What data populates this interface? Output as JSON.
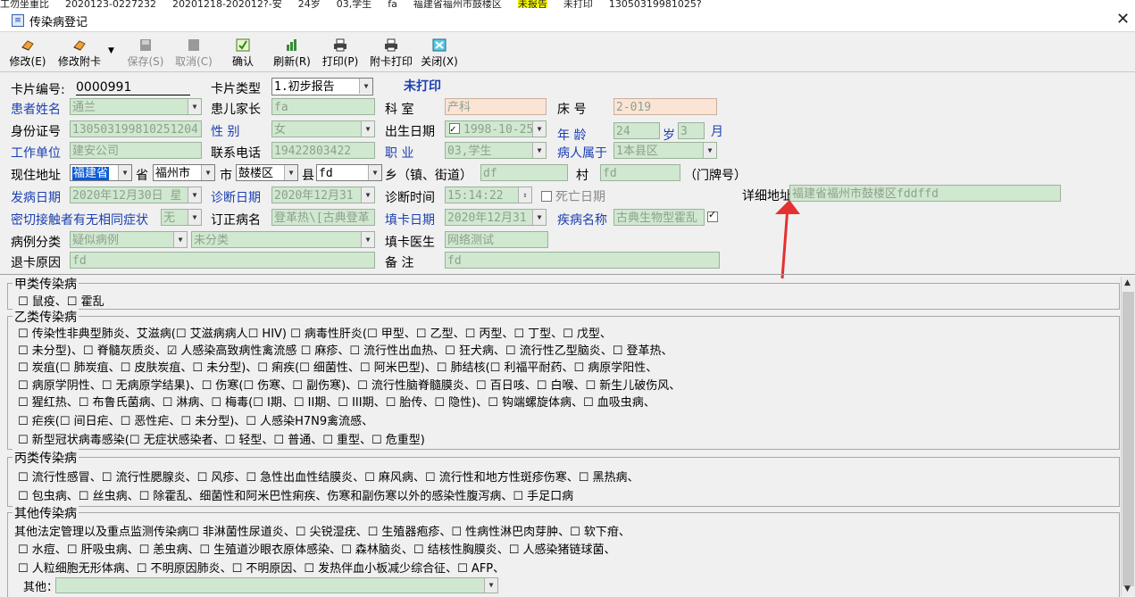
{
  "background_row": {
    "cells": [
      "工勿坐重比",
      "2020123-0227232",
      "20201218-202012?-安",
      "24岁",
      "03,学生",
      "fa",
      "福建省福州市鼓楼区",
      "未报告",
      "未打印",
      "13050319981025?"
    ]
  },
  "window": {
    "title": "传染病登记",
    "close": "✕"
  },
  "toolbar": {
    "modify": "修改(E)",
    "modify_card": "修改附卡",
    "save": "保存(S)",
    "cancel": "取消(C)",
    "confirm": "确认",
    "refresh": "刷新(R)",
    "print": "打印(P)",
    "print_card": "附卡打印",
    "close": "关闭(X)"
  },
  "form": {
    "card_no_label": "卡片编号:",
    "card_no": "0000991",
    "card_type_label": "卡片类型",
    "card_type": "1.初步报告",
    "print_status": "未打印",
    "patient_name_label": "患者姓名",
    "patient_name": "通兰",
    "guardian_label": "患儿家长",
    "guardian": "fa",
    "dept_label": "科  室",
    "dept": "产科",
    "bed_label": "床  号",
    "bed": "2-019",
    "id_label": "身份证号",
    "id_no": "130503199810251204",
    "gender_label": "性  别",
    "gender": "女",
    "birth_label": "出生日期",
    "birth_date": "1998-10-25",
    "age_label": "年  龄",
    "age_years": "24",
    "age_year_unit": "岁",
    "age_months": "3",
    "age_month_unit": "月",
    "work_label": "工作单位",
    "work": "建安公司",
    "phone_label": "联系电话",
    "phone": "19422803422",
    "job_label": "职  业",
    "job": "03,学生",
    "belong_label": "病人属于",
    "belong": "1本县区",
    "addr_label": "现住地址",
    "province": "福建省",
    "province_unit": "省",
    "city": "福州市",
    "city_unit": "市",
    "district": "鼓楼区",
    "county_unit": "县",
    "county": "fd",
    "township_unit": "乡（镇、街道）",
    "township": "df",
    "village_unit": "村",
    "village": "fd",
    "house_no_unit": "（门牌号）",
    "detail_addr_label": "详细地址",
    "detail_addr": "福建省福州市鼓楼区fddffd",
    "onset_label": "发病日期",
    "onset_date": "2020年12月30日 星",
    "diag_date_label": "诊断日期",
    "diag_date": "2020年12月31",
    "diag_time_label": "诊断时间",
    "diag_time": "15:14:22",
    "death_label": "死亡日期",
    "contact_label": "密切接触者有无相同症状",
    "contact": "无",
    "corrected_label": "订正病名",
    "corrected": "登革热\\[古典登革",
    "fill_date_label": "填卡日期",
    "fill_date": "2020年12月31",
    "disease_label": "疾病名称",
    "disease": "古典生物型霍乱",
    "category_label": "病例分类",
    "category1": "疑似病例",
    "category2": "未分类",
    "doctor_label": "填卡医生",
    "doctor": "网络测试",
    "return_label": "退卡原因",
    "return_reason": "fd",
    "remark_label": "备  注",
    "remark": "fd"
  },
  "groups": {
    "a": {
      "title": "甲类传染病",
      "lines": [
        "☐ 鼠疫、☐ 霍乱"
      ]
    },
    "b": {
      "title": "乙类传染病",
      "lines": [
        "☐ 传染性非典型肺炎、艾滋病(☐ 艾滋病病人☐ HIV) ☐ 病毒性肝炎(☐ 甲型、☐ 乙型、☐ 丙型、☐ 丁型、☐ 戊型、",
        "☐ 未分型)、☐ 脊髓灰质炎、☑ 人感染高致病性禽流感 ☐ 麻疹、☐ 流行性出血热、☐ 狂犬病、☐ 流行性乙型脑炎、☐ 登革热、",
        "☐ 炭疽(☐ 肺炭疽、☐ 皮肤炭疽、☐ 未分型)、☐ 痢疾(☐ 细菌性、☐ 阿米巴型)、☐ 肺结核(☐ 利福平耐药、☐ 病原学阳性、",
        "☐ 病原学阴性、☐ 无病原学结果)、☐ 伤寒(☐ 伤寒、☐ 副伤寒)、☐ 流行性脑脊髓膜炎、☐ 百日咳、☐ 白喉、☐ 新生儿破伤风、",
        "☐ 猩红热、☐ 布鲁氏菌病、☐ 淋病、☐ 梅毒(☐ I期、☐ II期、☐ III期、☐ 胎传、☐ 隐性)、☐ 钩端螺旋体病、☐ 血吸虫病、",
        "☐ 疟疾(☐ 间日疟、☐ 恶性疟、☐ 未分型)、☐ 人感染H7N9禽流感、",
        "☐ 新型冠状病毒感染(☐ 无症状感染者、☐ 轻型、☐ 普通、☐ 重型、☐ 危重型)"
      ]
    },
    "c": {
      "title": "丙类传染病",
      "lines": [
        "☐ 流行性感冒、☐ 流行性腮腺炎、☐ 风疹、☐ 急性出血性结膜炎、☐ 麻风病、☐ 流行性和地方性斑疹伤寒、☐ 黑热病、",
        "☐ 包虫病、☐ 丝虫病、☐ 除霍乱、细菌性和阿米巴性痢疾、伤寒和副伤寒以外的感染性腹泻病、☐ 手足口病"
      ]
    },
    "d": {
      "title": "其他传染病",
      "lines": [
        "其他法定管理以及重点监测传染病☐ 非淋菌性尿道炎、☐ 尖锐湿疣、☐ 生殖器疱疹、☐ 性病性淋巴肉芽肿、☐ 软下疳、",
        "☐ 水痘、☐ 肝吸虫病、☐ 恙虫病、☐ 生殖道沙眼衣原体感染、☐ 森林脑炎、☐ 结核性胸膜炎、☐ 人感染猪链球菌、",
        "☐ 人粒细胞无形体病、☐ 不明原因肺炎、☐ 不明原因、☐ 发热伴血小板减少综合征、☐ AFP、"
      ],
      "other_label": "其他："
    }
  },
  "colors": {
    "field_green": "#cfe8cf",
    "field_pink": "#fbe4d4",
    "label_blue": "#1b3fb0",
    "arrow": "#e53030"
  }
}
